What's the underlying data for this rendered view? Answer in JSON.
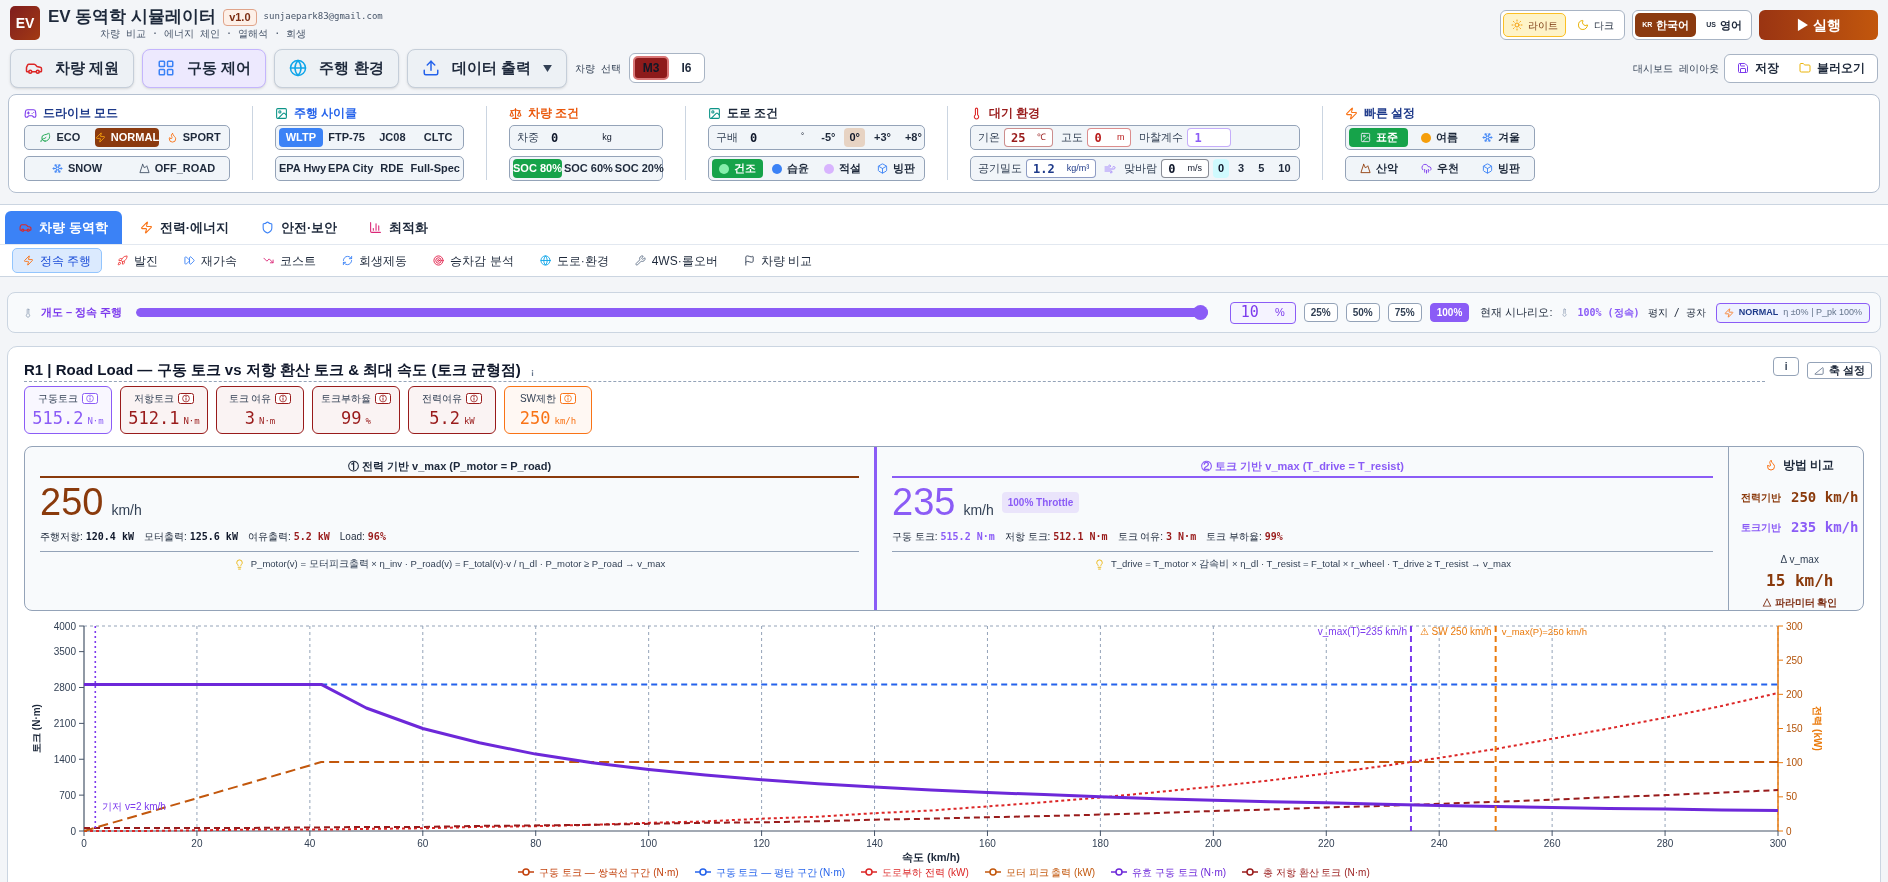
{
  "header": {
    "logo": "EV",
    "title": "EV 동역학 시뮬레이터",
    "version": "v1.0",
    "email": "sunjaepark83@gmail.com",
    "subtitle": "차량 비교 · 에너지 체인 · 열해석 · 회생"
  },
  "theme": [
    {
      "label": "라이트",
      "selected": true
    },
    {
      "label": "다크",
      "selected": false
    }
  ],
  "language": [
    {
      "code": "KR",
      "label": "한국어",
      "selected": true
    },
    {
      "code": "US",
      "label": "영어",
      "selected": false
    }
  ],
  "run_button": "▶ 실행",
  "nav": [
    {
      "label": "차량 제원",
      "selected": false,
      "dropdown": false
    },
    {
      "label": "구동 제어",
      "selected": true,
      "dropdown": false
    },
    {
      "label": "주행 환경",
      "selected": false,
      "dropdown": false
    },
    {
      "label": "데이터 출력",
      "selected": false,
      "dropdown": true
    }
  ],
  "vehicle_select": {
    "label": "차량 선택",
    "options": [
      {
        "label": "M3",
        "selected": true
      },
      {
        "label": "I6",
        "selected": false
      }
    ]
  },
  "layout": {
    "label": "대시보드 레이아웃",
    "buttons": [
      "저장",
      "불러오기"
    ]
  },
  "settings": [
    {
      "title": "드라이브 모드",
      "color": "#1e3a8a",
      "rows": [
        {
          "color": "#8b3a0f",
          "items": [
            {
              "kind": "option",
              "label": "ECO",
              "selected": false
            },
            {
              "kind": "option",
              "label": "NORMAL",
              "selected": true
            },
            {
              "kind": "option",
              "label": "SPORT",
              "selected": false
            }
          ]
        },
        {
          "items": [
            {
              "kind": "option",
              "label": "SNOW",
              "selected": false
            },
            {
              "kind": "option",
              "label": "OFF_ROAD",
              "selected": false
            }
          ]
        }
      ]
    },
    {
      "title": "주행 사이클",
      "color": "#2563eb",
      "rows": [
        {
          "color": "#3b82f6",
          "items": [
            {
              "kind": "option",
              "label": "WLTP",
              "selected": true
            },
            {
              "kind": "option",
              "label": "FTP-75",
              "selected": false
            },
            {
              "kind": "option",
              "label": "JC08",
              "selected": false
            },
            {
              "kind": "option",
              "label": "CLTC",
              "selected": false
            }
          ]
        },
        {
          "items": [
            {
              "kind": "option",
              "label": "EPA Hwy",
              "selected": false
            },
            {
              "kind": "option",
              "label": "EPA City",
              "selected": false
            },
            {
              "kind": "option",
              "label": "RDE",
              "selected": false
            },
            {
              "kind": "option",
              "label": "Full-Spec",
              "selected": false
            }
          ]
        }
      ]
    },
    {
      "title": "차량 조건",
      "color": "#ea580c",
      "rows": [
        {
          "items": [
            {
              "kind": "input",
              "label": "차중",
              "value": "0",
              "unit": "kg",
              "color": "#0f172a",
              "framed": false
            }
          ]
        },
        {
          "color": "#16a34a",
          "items": [
            {
              "kind": "option",
              "label": "SOC 80%",
              "selected": true
            },
            {
              "kind": "option",
              "label": "SOC 60%",
              "selected": false
            },
            {
              "kind": "option",
              "label": "SOC 20%",
              "selected": false
            }
          ]
        }
      ]
    },
    {
      "title": "도로 조건",
      "color": "#1e293b",
      "rows": [
        {
          "color": "#e7d3c3",
          "items": [
            {
              "kind": "input",
              "label": "구배",
              "value": "0",
              "unit": "˚",
              "color": "#0f172a",
              "framed": false
            },
            {
              "kind": "option",
              "label": "-5°",
              "selected": false
            },
            {
              "kind": "option",
              "label": "0°",
              "selected": true
            },
            {
              "kind": "option",
              "label": "+3°",
              "selected": false
            },
            {
              "kind": "option",
              "label": "+8°",
              "selected": false
            }
          ]
        },
        {
          "color": "#16a34a",
          "items": [
            {
              "kind": "option",
              "label": "건조",
              "selected": true
            },
            {
              "kind": "option",
              "label": "습윤",
              "selected": false
            },
            {
              "kind": "option",
              "label": "적설",
              "selected": false
            },
            {
              "kind": "option",
              "label": "빙판",
              "selected": false
            }
          ]
        }
      ]
    },
    {
      "title": "대기 환경",
      "color": "#991b1b",
      "rows": [
        {
          "items": [
            {
              "kind": "input",
              "label": "기온",
              "value": "25",
              "unit": "℃",
              "color": "#991b1b",
              "framed": true
            },
            {
              "kind": "input",
              "label": "고도",
              "value": "0",
              "unit": "m",
              "color": "#b91c1c",
              "framed": true
            },
            {
              "kind": "input",
              "label": "마찰계수",
              "value": "1",
              "color": "#8b5cf6",
              "framed": true
            }
          ]
        },
        {
          "color": "#cffafe",
          "items": [
            {
              "kind": "input",
              "label": "공기밀도",
              "value": "1.2",
              "unit": "kg/m³",
              "color": "#1e3a8a",
              "framed": true
            },
            {
              "kind": "input",
              "label": "맞바람",
              "value": "0",
              "unit": "m/s",
              "color": "#0f172a",
              "framed": true,
              "icon": true
            },
            {
              "kind": "option",
              "label": "0",
              "selected": true
            },
            {
              "kind": "option",
              "label": "3",
              "selected": false
            },
            {
              "kind": "option",
              "label": "5",
              "selected": false
            },
            {
              "kind": "option",
              "label": "10",
              "selected": false
            }
          ]
        }
      ]
    },
    {
      "title": "빠른 설정",
      "color": "#1e3a8a",
      "rows": [
        {
          "color": "#16a34a",
          "items": [
            {
              "kind": "option",
              "label": "표준",
              "selected": true
            },
            {
              "kind": "option",
              "label": "여름",
              "selected": false
            },
            {
              "kind": "option",
              "label": "겨울",
              "selected": false
            }
          ]
        },
        {
          "items": [
            {
              "kind": "option",
              "label": "산악",
              "selected": false
            },
            {
              "kind": "option",
              "label": "우천",
              "selected": false
            },
            {
              "kind": "option",
              "label": "빙판",
              "selected": false
            }
          ]
        }
      ]
    }
  ],
  "tabs": [
    {
      "label": "차량 동역학",
      "selected": true
    },
    {
      "label": "전력·에너지",
      "selected": false
    },
    {
      "label": "안전·보안",
      "selected": false
    },
    {
      "label": "최적화",
      "selected": false
    }
  ],
  "subtabs": [
    {
      "label": "정속 주행",
      "selected": true
    },
    {
      "label": "발진",
      "selected": false
    },
    {
      "label": "재가속",
      "selected": false
    },
    {
      "label": "코스트",
      "selected": false
    },
    {
      "label": "회생제동",
      "selected": false
    },
    {
      "label": "승차감 분석",
      "selected": false
    },
    {
      "label": "도로·환경",
      "selected": false
    },
    {
      "label": "4WS·롤오버",
      "selected": false
    },
    {
      "label": "차량 비교",
      "selected": false
    }
  ],
  "throttle": {
    "label": "개도 – 정속 주행",
    "level": 1.0,
    "value": "10",
    "unit": "%",
    "presets": [
      {
        "label": "25%",
        "selected": false
      },
      {
        "label": "50%",
        "selected": false
      },
      {
        "label": "75%",
        "selected": false
      },
      {
        "label": "100%",
        "selected": true
      }
    ],
    "scenario_label": "현재 시나리오:",
    "scenario": "100% (정속)",
    "condition": "평지 / 공차",
    "mode": "NORMAL",
    "mode_detail": "η ±0% | P_pk 100%"
  },
  "analysis": {
    "title": "R1 | Road Load — 구동 토크 vs 저항 환산 토크 & 최대 속도 (토크 균형점)",
    "info_button": "i",
    "axis_button": "축 설정",
    "metrics": [
      {
        "label": "구동토크",
        "value": "515.2",
        "unit": "N·m",
        "color": "#8b5cf6"
      },
      {
        "label": "저항토크",
        "value": "512.1",
        "unit": "N·m",
        "color": "#991b1b"
      },
      {
        "label": "토크 여유",
        "value": "3",
        "unit": "N·m",
        "color": "#991b1b"
      },
      {
        "label": "토크부하율",
        "value": "99",
        "unit": "%",
        "color": "#991b1b"
      },
      {
        "label": "전력여유",
        "value": "5.2",
        "unit": "kW",
        "color": "#991b1b"
      },
      {
        "label": "SW제한",
        "value": "250",
        "unit": "km/h",
        "color": "#f97316"
      }
    ],
    "methods": [
      {
        "heading": "① 전력 기반 v_max (P_motor = P_road)",
        "color": "#8a3a0c",
        "value": "250",
        "unit": "km/h",
        "stats": [
          {
            "label": "주행저항:",
            "value": "120.4 kW",
            "color": "#0f172a"
          },
          {
            "label": "모터출력:",
            "value": "125.6 kW",
            "color": "#0f172a"
          },
          {
            "label": "여유출력:",
            "value": "5.2 kW",
            "color": "#991b1b"
          },
          {
            "label": "Load:",
            "value": "96%",
            "color": "#991b1b"
          }
        ],
        "formula": "P_motor(v) = 모터피크출력 × η_inv · P_road(v) = F_total(v)·v / η_dl · P_motor ≥ P_road → v_max"
      },
      {
        "heading": "② 토크 기반 v_max (T_drive = T_resist)",
        "color": "#8b5cf6",
        "value": "235",
        "unit": "km/h",
        "tag": "100% Throttle",
        "stats": [
          {
            "label": "구동 토크:",
            "value": "515.2 N·m",
            "color": "#8b5cf6"
          },
          {
            "label": "저항 토크:",
            "value": "512.1 N·m",
            "color": "#991b1b"
          },
          {
            "label": "토크 여유:",
            "value": "3 N·m",
            "color": "#991b1b"
          },
          {
            "label": "토크 부하율:",
            "value": "99%",
            "color": "#991b1b"
          }
        ],
        "formula": "T_drive = T_motor × 감속비 × η_dl · T_resist = F_total × r_wheel · T_drive ≥ T_resist → v_max"
      }
    ],
    "comparison": {
      "title": "방법 비교",
      "rows": [
        {
          "label": "전력기반",
          "value": "250 km/h",
          "color": "#8a3a0c"
        },
        {
          "label": "토크기반",
          "value": "235 km/h",
          "color": "#8b5cf6"
        }
      ],
      "delta_label": "Δ v_max",
      "delta": "15 km/h",
      "note": "△ 파라미터 확인"
    },
    "chart_data": {
      "type": "line",
      "xlabel": "속도 (km/h)",
      "ylabel": "토크 (N·m)",
      "y2label": "전력 (kW)",
      "xlim": [
        0,
        300
      ],
      "ylim": [
        0,
        4000
      ],
      "y2lim": [
        0,
        300
      ],
      "xticks": [
        0,
        20,
        40,
        60,
        80,
        100,
        120,
        140,
        160,
        180,
        200,
        220,
        240,
        260,
        280,
        300
      ],
      "yticks": [
        0,
        700,
        1400,
        2100,
        2800,
        3500,
        4000
      ],
      "y2ticks": [
        0,
        50,
        100,
        150,
        200,
        250,
        300
      ],
      "grid": true,
      "legend": "bottom",
      "x": [
        0,
        10,
        20,
        30,
        40,
        42,
        50,
        60,
        70,
        80,
        90,
        100,
        110,
        120,
        130,
        140,
        150,
        160,
        170,
        180,
        190,
        200,
        210,
        220,
        230,
        240,
        250,
        260,
        270,
        280,
        290,
        300
      ],
      "series": [
        {
          "name": "구동 토크 — 쌍곡선 구간 (N·m)",
          "color": "#c2410c",
          "values": [
            null,
            null,
            null,
            null,
            null,
            null,
            null,
            null,
            null,
            null,
            null,
            null,
            null,
            null,
            null,
            null,
            null,
            null,
            null,
            null,
            null,
            null,
            null,
            null,
            null,
            null,
            null,
            null,
            null,
            null,
            null,
            null
          ]
        },
        {
          "name": "구동 토크 — 평탄 구간 (N·m)",
          "color": "#2563eb",
          "line_style": "dashed",
          "values": [
            null,
            null,
            null,
            null,
            null,
            2860,
            2860,
            2860,
            2860,
            2860,
            2860,
            2860,
            2860,
            2860,
            2860,
            2860,
            2860,
            2860,
            2860,
            2860,
            2860,
            2860,
            2860,
            2860,
            2860,
            2860,
            2860,
            2860,
            2860,
            2860,
            2860,
            2860
          ]
        },
        {
          "name": "도로부하 전력 (kW)",
          "color": "#dc2626",
          "axis": "y2",
          "line_style": "dotted",
          "values": [
            0,
            0,
            1,
            2,
            2,
            2,
            3,
            4,
            6,
            7,
            9,
            12,
            14,
            18,
            21,
            26,
            30,
            36,
            42,
            49,
            57,
            65,
            74,
            84,
            95,
            107,
            120,
            135,
            150,
            166,
            183,
            202
          ]
        },
        {
          "name": "모터 피크 출력 (kW)",
          "color": "#c2570c",
          "axis": "y2",
          "line_style": "dashed",
          "values": [
            0,
            24,
            48,
            72,
            96,
            101,
            101,
            101,
            101,
            101,
            101,
            101,
            101,
            101,
            101,
            101,
            101,
            101,
            101,
            101,
            101,
            101,
            101,
            101,
            101,
            101,
            101,
            101,
            101,
            101,
            101,
            101
          ]
        },
        {
          "name": "유효 구동 토크 (N·m)",
          "color": "#6d28d9",
          "values": [
            2860,
            2860,
            2860,
            2860,
            2860,
            2860,
            2400,
            2000,
            1720,
            1500,
            1330,
            1200,
            1090,
            1000,
            920,
            860,
            800,
            750,
            710,
            670,
            630,
            600,
            570,
            550,
            520,
            500,
            480,
            460,
            440,
            430,
            410,
            400
          ]
        },
        {
          "name": "총 저항 환산 토크 (N·m)",
          "color": "#991b1b",
          "line_style": "dashed",
          "values": [
            60,
            60,
            60,
            60,
            70,
            70,
            80,
            80,
            100,
            110,
            120,
            140,
            160,
            170,
            190,
            220,
            240,
            270,
            290,
            320,
            350,
            390,
            420,
            460,
            490,
            530,
            570,
            610,
            660,
            700,
            750,
            800
          ]
        }
      ],
      "ref_lines": [
        {
          "axis": "x",
          "value": 2,
          "label": "기저 v=2 km/h",
          "color": "#7c3aed"
        },
        {
          "axis": "x",
          "value": 235,
          "label": "v_max(T)=235 km/h",
          "color": "#7c3aed"
        },
        {
          "axis": "x",
          "value": 250,
          "label": "⚠ SW 250 km/h",
          "color": "#ea7a0c"
        }
      ],
      "annotations": [
        "v_max(P)=250 km/h"
      ]
    }
  }
}
